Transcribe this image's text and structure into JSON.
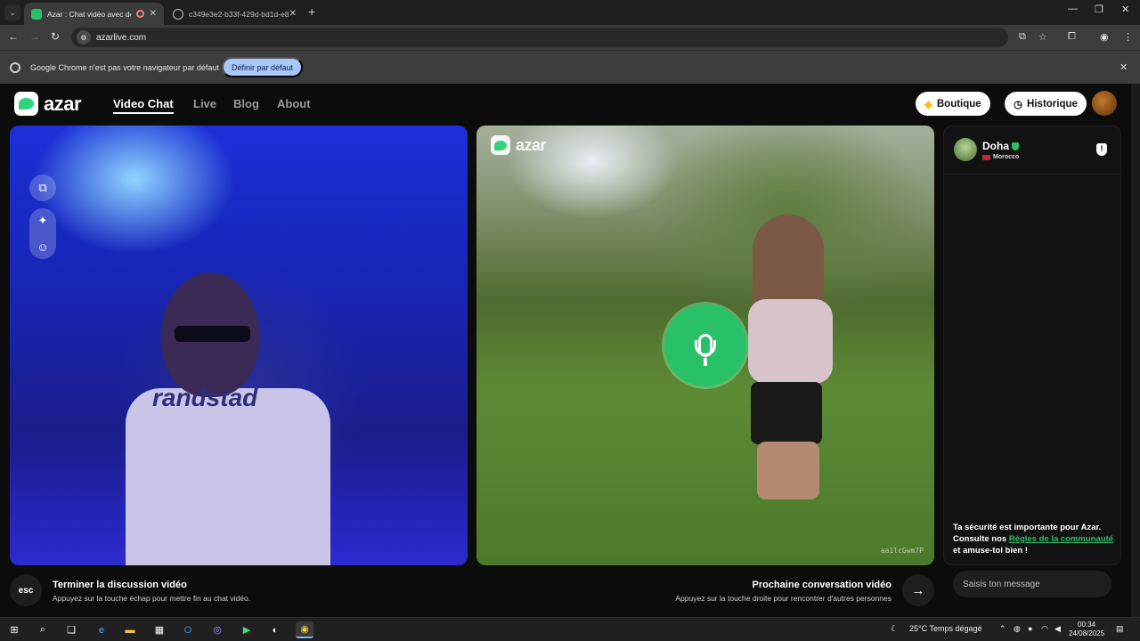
{
  "browser": {
    "tabs": [
      {
        "title": "Azar : Chat vidéo avec de n",
        "active": true
      },
      {
        "title": "c349e3e2-b33f-429d-bd1d-e8",
        "active": false
      }
    ],
    "address": "azarlive.com",
    "infobar": {
      "message": "Google Chrome n'est pas votre navigateur par défaut",
      "button": "Définir par défaut"
    }
  },
  "header": {
    "brand": "azar",
    "nav": [
      "Video Chat",
      "Live",
      "Blog",
      "About"
    ],
    "boutique": "Boutique",
    "historique": "Historique"
  },
  "partner_video": {
    "brand": "azar",
    "id": "aa1lcGwm7P"
  },
  "chat": {
    "partner_name": "Doha",
    "partner_country": "Morocco",
    "safety_part1": "Ta sécurité est importante pour Azar. Consulte nos ",
    "safety_link": "Règles de la communauté",
    "safety_part2": " et amuse-toi bien !",
    "input_placeholder": "Saisis ton message"
  },
  "footer": {
    "esc_key": "esc",
    "end_title": "Terminer la discussion vidéo",
    "end_subtitle": "Appuyez sur la touche échap pour mettre fin au chat vidéo.",
    "next_title": "Prochaine conversation vidéo",
    "next_subtitle": "Appuyez sur la touche droite pour rencontrer d'autres personnes"
  },
  "taskbar": {
    "weather": "25°C  Temps dégagé",
    "time": "00:34",
    "date": "24/08/2025"
  },
  "colors": {
    "accent": "#29c167",
    "page_bg": "#0c0c0d",
    "infobar_button": "#a8c7fa"
  }
}
